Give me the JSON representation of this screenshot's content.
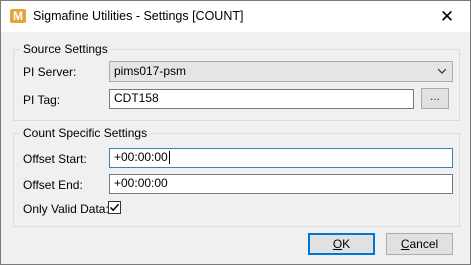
{
  "window": {
    "title": "Sigmafine Utilities - Settings [COUNT]",
    "app_icon_glyph": "M",
    "close_glyph": "✕"
  },
  "source_settings": {
    "legend": "Source Settings",
    "pi_server_label": "PI Server:",
    "pi_server_value": "pims017-psm",
    "pi_tag_label": "PI Tag:",
    "pi_tag_value": "CDT158",
    "browse_label": "..."
  },
  "count_settings": {
    "legend": "Count Specific Settings",
    "offset_start_label": "Offset Start:",
    "offset_start_value": "+00:00:00",
    "offset_end_label": "Offset End:",
    "offset_end_value": "+00:00:00",
    "only_valid_label": "Only Valid Data:",
    "only_valid_checked": true
  },
  "buttons": {
    "ok_mnemonic": "O",
    "ok_rest": "K",
    "cancel_mnemonic": "C",
    "cancel_rest": "ancel"
  },
  "colors": {
    "accent": "#0078d7",
    "icon": "#e8a23a"
  }
}
